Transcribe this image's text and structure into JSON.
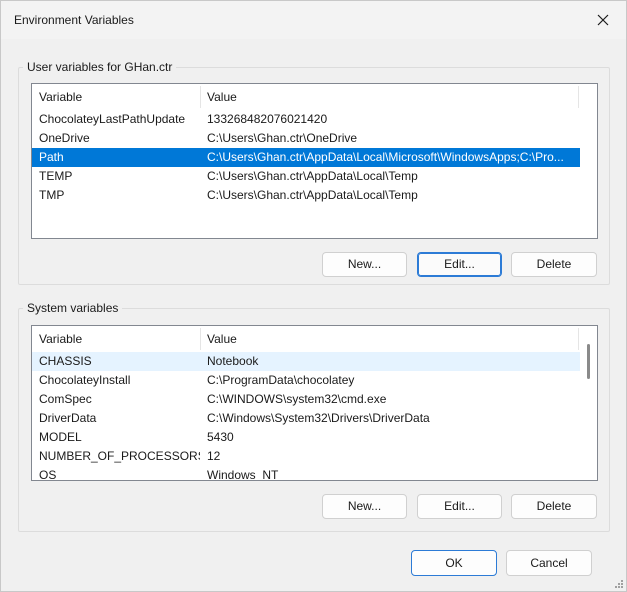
{
  "window": {
    "title": "Environment Variables"
  },
  "user_vars": {
    "group_label": "User variables for GHan.ctr",
    "columns": [
      "Variable",
      "Value"
    ],
    "rows": [
      {
        "name": "ChocolateyLastPathUpdate",
        "value": "133268482076021420"
      },
      {
        "name": "OneDrive",
        "value": "C:\\Users\\Ghan.ctr\\OneDrive"
      },
      {
        "name": "Path",
        "value": "C:\\Users\\Ghan.ctr\\AppData\\Local\\Microsoft\\WindowsApps;C:\\Pro..."
      },
      {
        "name": "TEMP",
        "value": "C:\\Users\\Ghan.ctr\\AppData\\Local\\Temp"
      },
      {
        "name": "TMP",
        "value": "C:\\Users\\Ghan.ctr\\AppData\\Local\\Temp"
      }
    ],
    "selected_index": 2,
    "buttons": {
      "new": "New...",
      "edit": "Edit...",
      "delete": "Delete"
    }
  },
  "system_vars": {
    "group_label": "System variables",
    "columns": [
      "Variable",
      "Value"
    ],
    "rows": [
      {
        "name": "CHASSIS",
        "value": "Notebook"
      },
      {
        "name": "ChocolateyInstall",
        "value": "C:\\ProgramData\\chocolatey"
      },
      {
        "name": "ComSpec",
        "value": "C:\\WINDOWS\\system32\\cmd.exe"
      },
      {
        "name": "DriverData",
        "value": "C:\\Windows\\System32\\Drivers\\DriverData"
      },
      {
        "name": "MODEL",
        "value": "5430"
      },
      {
        "name": "NUMBER_OF_PROCESSORS",
        "value": "12"
      },
      {
        "name": "OS",
        "value": "Windows_NT"
      }
    ],
    "hovered_index": 0,
    "buttons": {
      "new": "New...",
      "edit": "Edit...",
      "delete": "Delete"
    }
  },
  "footer": {
    "ok": "OK",
    "cancel": "Cancel"
  },
  "colors": {
    "selection": "#0078d7",
    "hover": "#e5f3ff",
    "focus_border": "#2c7bd6"
  },
  "icons": {
    "close": "close-icon",
    "resize": "resize-grip-icon"
  }
}
